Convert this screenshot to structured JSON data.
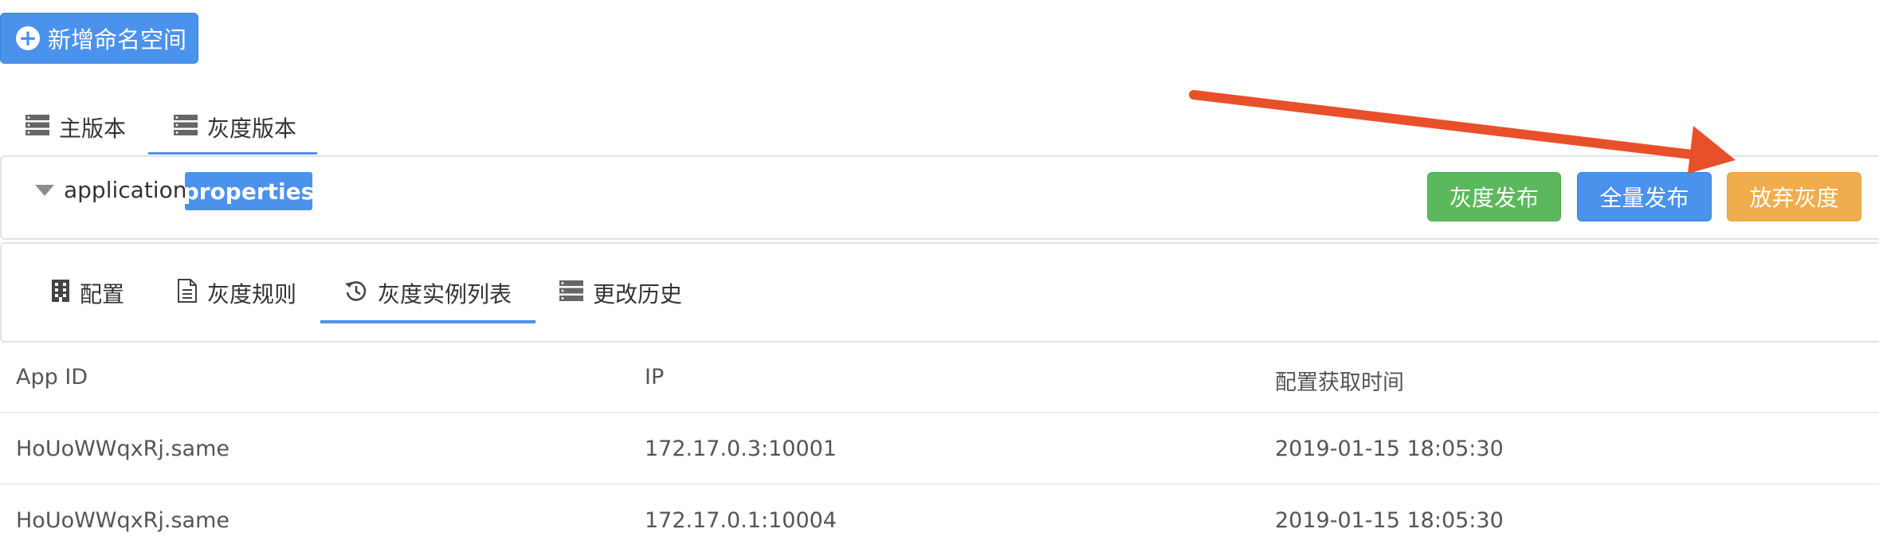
{
  "toolbar": {
    "add_namespace_label": "新增命名空间"
  },
  "version_tabs": [
    {
      "label": "主版本",
      "icon": "server-icon",
      "active": false
    },
    {
      "label": "灰度版本",
      "icon": "server-icon",
      "active": true
    }
  ],
  "namespace": {
    "name": "application",
    "format_badge": "properties"
  },
  "actions": {
    "gray_release": "灰度发布",
    "full_release": "全量发布",
    "abandon_gray": "放弃灰度"
  },
  "sub_tabs": [
    {
      "label": "配置",
      "icon": "building-icon",
      "active": false
    },
    {
      "label": "灰度规则",
      "icon": "document-icon",
      "active": false
    },
    {
      "label": "灰度实例列表",
      "icon": "history-icon",
      "active": true
    },
    {
      "label": "更改历史",
      "icon": "server-icon",
      "active": false
    }
  ],
  "table": {
    "columns": [
      "App ID",
      "IP",
      "配置获取时间"
    ],
    "rows": [
      [
        "HoUoWWqxRj.same",
        "172.17.0.3:10001",
        "2019-01-15 18:05:30"
      ],
      [
        "HoUoWWqxRj.same",
        "172.17.0.1:10004",
        "2019-01-15 18:05:30"
      ]
    ]
  },
  "colors": {
    "primary": "#4b92ec",
    "success": "#5cb85c",
    "warning": "#f0ad4e",
    "annotation_arrow": "#e8502a"
  }
}
